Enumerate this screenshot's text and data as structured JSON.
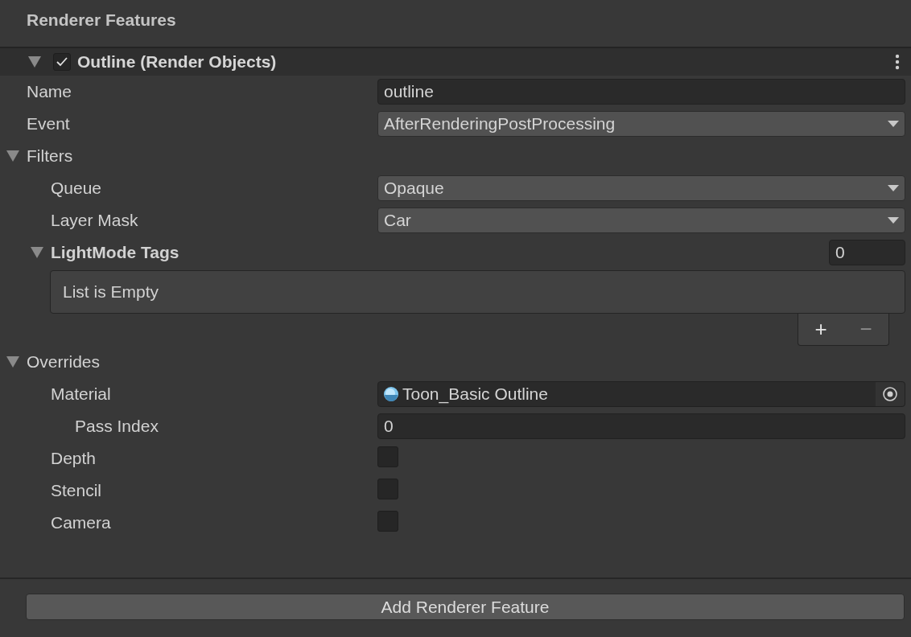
{
  "section_title": "Renderer Features",
  "feature": {
    "title": "Outline (Render Objects)",
    "expanded": true,
    "enabled": true
  },
  "properties": [
    {
      "kind": "text",
      "label": "Name",
      "value": "outline"
    },
    {
      "kind": "dropdown",
      "label": "Event",
      "value": "AfterRenderingPostProcessing"
    },
    {
      "kind": "group",
      "label": "Filters",
      "expanded": true,
      "children": [
        {
          "kind": "dropdown",
          "label": "Queue",
          "value": "Opaque"
        },
        {
          "kind": "dropdown",
          "label": "Layer Mask",
          "value": "Car"
        },
        {
          "kind": "list",
          "label": "LightMode Tags",
          "expanded": true,
          "count": "0",
          "empty_text": "List is Empty",
          "add": "+",
          "remove": "−"
        }
      ]
    },
    {
      "kind": "group",
      "label": "Overrides",
      "expanded": true,
      "children": [
        {
          "kind": "object",
          "label": "Material",
          "value": "Toon_Basic Outline",
          "children": [
            {
              "kind": "text",
              "label": "Pass Index",
              "value": "0"
            }
          ]
        },
        {
          "kind": "checkbox",
          "label": "Depth",
          "checked": false
        },
        {
          "kind": "checkbox",
          "label": "Stencil",
          "checked": false
        },
        {
          "kind": "checkbox",
          "label": "Camera",
          "checked": false
        }
      ]
    }
  ],
  "add_button": "Add Renderer Feature"
}
